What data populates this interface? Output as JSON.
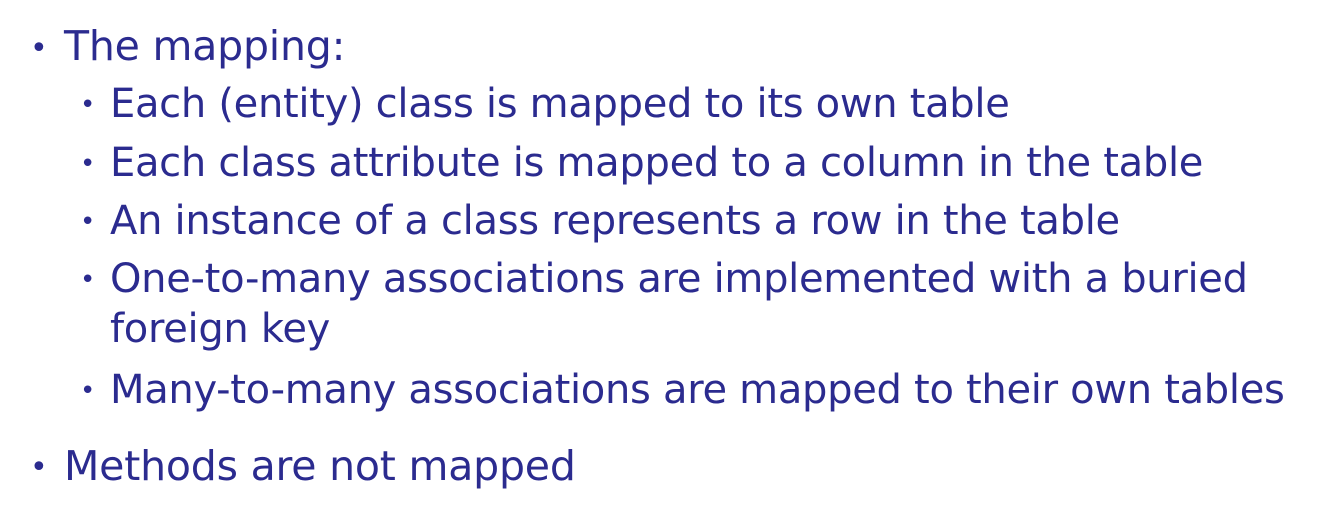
{
  "bullets": [
    {
      "text": "The mapping:",
      "children": [
        {
          "text": "Each (entity) class is mapped to its own table"
        },
        {
          "text": "Each class attribute is mapped to a column in the table"
        },
        {
          "text": "An instance of a class represents a row in the table"
        },
        {
          "text": "One-to-many associations are implemented with a buried",
          "continuation": "foreign key"
        },
        {
          "text": "Many-to-many associations are mapped to their own tables"
        }
      ]
    },
    {
      "text": "Methods are not mapped"
    }
  ],
  "bullet_glyph": "•",
  "text_color": "#2b2b8f"
}
